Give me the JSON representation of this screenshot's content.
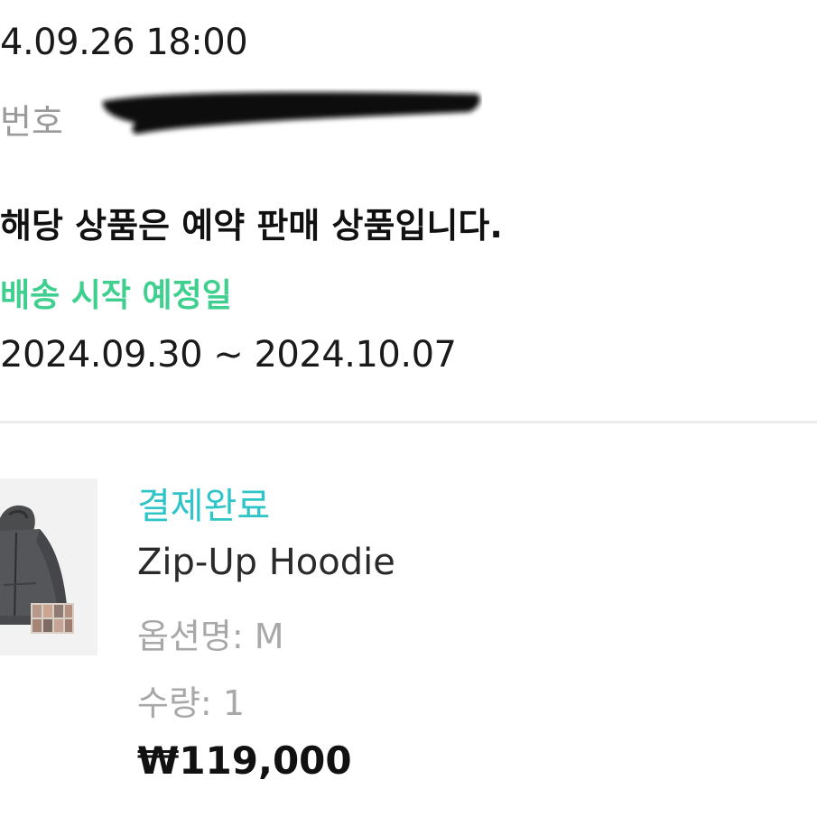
{
  "order": {
    "date": "4.09.26 18:00",
    "number_label": "번호",
    "notice": "해당 상품은 예약 판매 상품입니다.",
    "shipping_label": "배송 시작 예정일",
    "shipping_range": "2024.09.30 ~ 2024.10.07"
  },
  "product": {
    "status": "결제완료",
    "name": "Zip-Up Hoodie",
    "option_label": "옵션명:",
    "option_value": "M",
    "quantity_label": "수량:",
    "quantity_value": "1",
    "price": "₩119,000"
  },
  "colors": {
    "shipping_accent": "#3fcf8e",
    "status_accent": "#2ec4c8",
    "muted_text": "#a8a8a8"
  }
}
